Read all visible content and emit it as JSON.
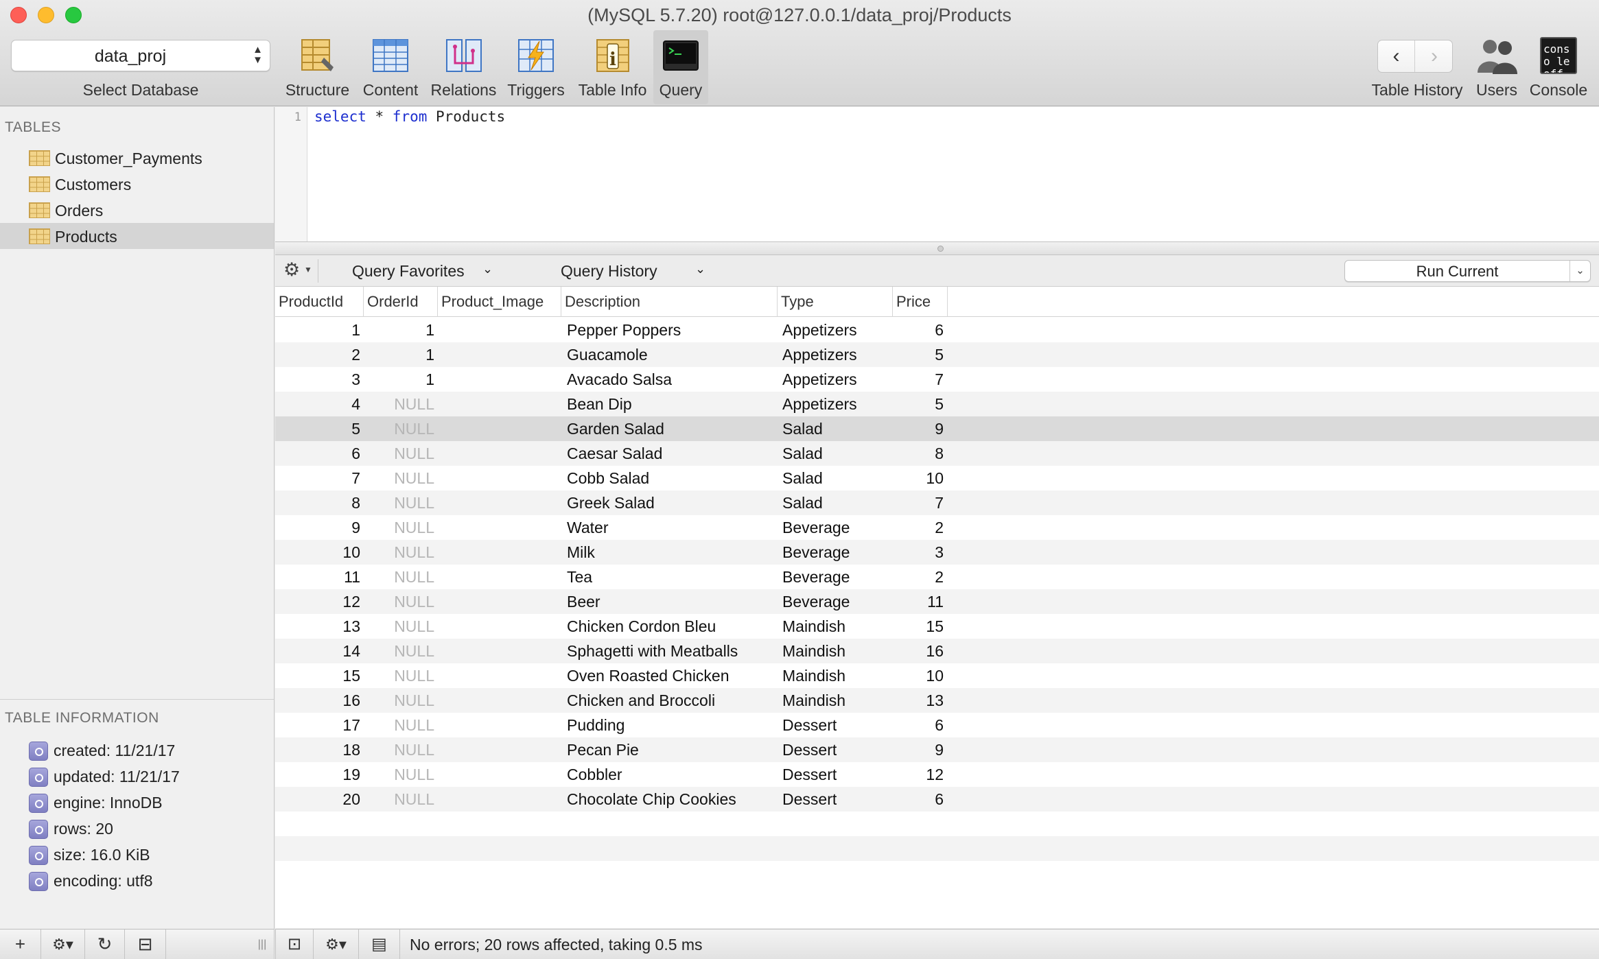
{
  "window": {
    "title": "(MySQL 5.7.20) root@127.0.0.1/data_proj/Products"
  },
  "toolbar": {
    "database": {
      "value": "data_proj",
      "label": "Select Database",
      "arrows": "⌃⌄"
    },
    "buttons": {
      "structure": "Structure",
      "content": "Content",
      "relations": "Relations",
      "triggers": "Triggers",
      "table_info": "Table Info",
      "query": "Query"
    },
    "nav_back": "‹",
    "nav_forward": "›",
    "table_history": "Table History",
    "users": "Users",
    "console": "Console",
    "console_icon_text": "conso le off",
    "active": "query"
  },
  "sidebar": {
    "tables_heading": "TABLES",
    "tables": [
      "Customer_Payments",
      "Customers",
      "Orders",
      "Products"
    ],
    "selected_table": "Products",
    "info_heading": "TABLE INFORMATION",
    "info": [
      "created: 11/21/17",
      "updated: 11/21/17",
      "engine: InnoDB",
      "rows: 20",
      "size: 16.0 KiB",
      "encoding: utf8"
    ],
    "bottom": {
      "add": "+",
      "gear": "⚙▾",
      "refresh": "↻",
      "filter": "⊟",
      "resize": "|||"
    }
  },
  "editor": {
    "line_number": "1",
    "query_tokens": {
      "kw1": "select",
      "sym": " * ",
      "kw2": "from",
      "table": " Products"
    }
  },
  "query_bar": {
    "gear": "⚙",
    "favorites": "Query Favorites",
    "history": "Query History",
    "run": "Run Current",
    "caret": "⌄"
  },
  "results": {
    "columns": [
      "ProductId",
      "OrderId",
      "Product_Image",
      "Description",
      "Type",
      "Price"
    ],
    "null_text": "NULL",
    "selected_row_index": 4,
    "rows": [
      [
        1,
        1,
        "",
        "Pepper Poppers",
        "Appetizers",
        6
      ],
      [
        2,
        1,
        "",
        "Guacamole",
        "Appetizers",
        5
      ],
      [
        3,
        1,
        "",
        "Avacado Salsa",
        "Appetizers",
        7
      ],
      [
        4,
        null,
        "",
        "Bean Dip",
        "Appetizers",
        5
      ],
      [
        5,
        null,
        "",
        "Garden Salad",
        "Salad",
        9
      ],
      [
        6,
        null,
        "",
        "Caesar Salad",
        "Salad",
        8
      ],
      [
        7,
        null,
        "",
        "Cobb Salad",
        "Salad",
        10
      ],
      [
        8,
        null,
        "",
        "Greek Salad",
        "Salad",
        7
      ],
      [
        9,
        null,
        "",
        "Water",
        "Beverage",
        2
      ],
      [
        10,
        null,
        "",
        "Milk",
        "Beverage",
        3
      ],
      [
        11,
        null,
        "",
        "Tea",
        "Beverage",
        2
      ],
      [
        12,
        null,
        "",
        "Beer",
        "Beverage",
        11
      ],
      [
        13,
        null,
        "",
        "Chicken Cordon Bleu",
        "Maindish",
        15
      ],
      [
        14,
        null,
        "",
        "Sphagetti with Meatballs",
        "Maindish",
        16
      ],
      [
        15,
        null,
        "",
        "Oven Roasted Chicken",
        "Maindish",
        10
      ],
      [
        16,
        null,
        "",
        "Chicken and Broccoli",
        "Maindish",
        13
      ],
      [
        17,
        null,
        "",
        "Pudding",
        "Dessert",
        6
      ],
      [
        18,
        null,
        "",
        "Pecan Pie",
        "Dessert",
        9
      ],
      [
        19,
        null,
        "",
        "Cobbler",
        "Dessert",
        12
      ],
      [
        20,
        null,
        "",
        "Chocolate Chip Cookies",
        "Dessert",
        6
      ]
    ]
  },
  "status": {
    "text": "No errors; 20 rows affected, taking 0.5 ms",
    "buttons": {
      "panel": "⊡",
      "gear": "⚙▾",
      "log": "▤"
    }
  }
}
